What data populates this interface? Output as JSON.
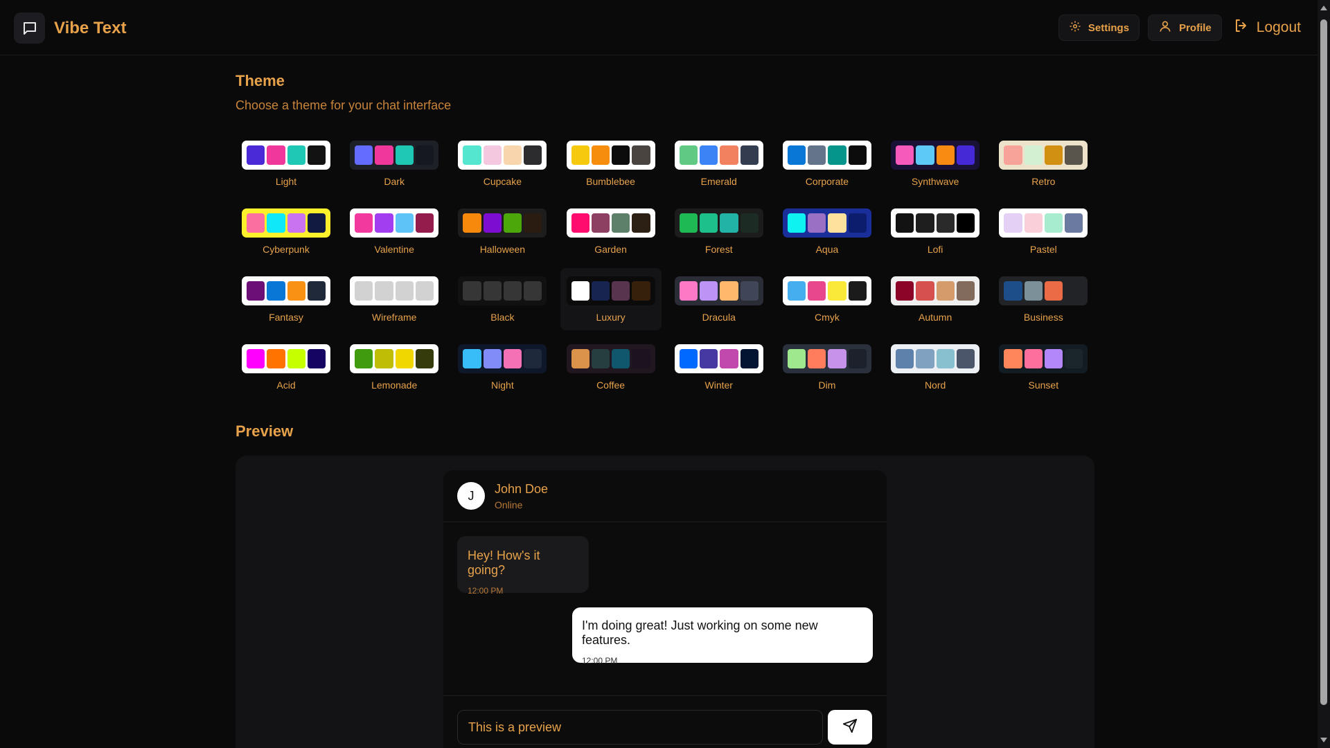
{
  "app": {
    "name": "Vibe Text"
  },
  "nav": {
    "settings": "Settings",
    "profile": "Profile",
    "logout": "Logout"
  },
  "theme_section": {
    "title": "Theme",
    "subtitle": "Choose a theme for your chat interface",
    "selected": "Luxury",
    "themes": [
      {
        "name": "Light",
        "colors": [
          "#4a2ad6",
          "#f0379b",
          "#1fc8b4",
          "#121212"
        ],
        "frame": "#ffffff"
      },
      {
        "name": "Dark",
        "colors": [
          "#646bff",
          "#f0379b",
          "#1fc8b4",
          "#151820"
        ],
        "frame": "#1d2026"
      },
      {
        "name": "Cupcake",
        "colors": [
          "#55e6cf",
          "#f4c9df",
          "#f9d5ad",
          "#2c2b2e"
        ],
        "frame": "#ffffff"
      },
      {
        "name": "Bumblebee",
        "colors": [
          "#f6c90e",
          "#f68d0c",
          "#0c0c0c",
          "#494440"
        ],
        "frame": "#ffffff"
      },
      {
        "name": "Emerald",
        "colors": [
          "#60c983",
          "#3c83f6",
          "#f2815f",
          "#343c4f"
        ],
        "frame": "#ffffff"
      },
      {
        "name": "Corporate",
        "colors": [
          "#0877d6",
          "#64748b",
          "#06958a",
          "#0c0c0c"
        ],
        "frame": "#ffffff"
      },
      {
        "name": "Synthwave",
        "colors": [
          "#f65aba",
          "#5cc9f7",
          "#f98b12",
          "#4528d6"
        ],
        "frame": "#1a1236"
      },
      {
        "name": "Retro",
        "colors": [
          "#f7a39a",
          "#d4f0d2",
          "#d29012",
          "#59554d"
        ],
        "frame": "#ece3ca"
      },
      {
        "name": "Cyberpunk",
        "colors": [
          "#fa6ea0",
          "#0ee8f8",
          "#c973f0",
          "#111a40"
        ],
        "frame": "#fcef2c"
      },
      {
        "name": "Valentine",
        "colors": [
          "#f2399e",
          "#a23ef0",
          "#5ec3f7",
          "#931c4c"
        ],
        "frame": "#ffffff"
      },
      {
        "name": "Halloween",
        "colors": [
          "#f78a0c",
          "#7d0dd0",
          "#4ca80a",
          "#2a1c10"
        ],
        "frame": "#1d1d1d"
      },
      {
        "name": "Garden",
        "colors": [
          "#ff0c6e",
          "#8d4062",
          "#5d806b",
          "#2b2013"
        ],
        "frame": "#ffffff"
      },
      {
        "name": "Forest",
        "colors": [
          "#1eb855",
          "#1dc08b",
          "#23b3a6",
          "#1c2b23"
        ],
        "frame": "#1c1c1c"
      },
      {
        "name": "Aqua",
        "colors": [
          "#0ef2f2",
          "#9a70c4",
          "#fde19c",
          "#0d1d6e"
        ],
        "frame": "#1a2e9a"
      },
      {
        "name": "Lofi",
        "colors": [
          "#121212",
          "#1e1e1e",
          "#2a2a2a",
          "#000000"
        ],
        "frame": "#ffffff"
      },
      {
        "name": "Pastel",
        "colors": [
          "#e4d0f5",
          "#fbcfd9",
          "#a8ecd0",
          "#6a7aa0"
        ],
        "frame": "#ffffff"
      },
      {
        "name": "Fantasy",
        "colors": [
          "#6c0f77",
          "#0877d6",
          "#f99214",
          "#20293a"
        ],
        "frame": "#ffffff"
      },
      {
        "name": "Wireframe",
        "colors": [
          "#d2d2d2",
          "#d2d2d2",
          "#d2d2d2",
          "#d2d2d2"
        ],
        "frame": "#ffffff"
      },
      {
        "name": "Black",
        "colors": [
          "#363636",
          "#363636",
          "#363636",
          "#363636"
        ],
        "frame": "#111111"
      },
      {
        "name": "Luxury",
        "colors": [
          "#ffffff",
          "#182450",
          "#58344e",
          "#361f0b"
        ],
        "frame": "#0b0b0b"
      },
      {
        "name": "Dracula",
        "colors": [
          "#fd79c6",
          "#be93f6",
          "#ffb86c",
          "#414558"
        ],
        "frame": "#2a2c36"
      },
      {
        "name": "Cmyk",
        "colors": [
          "#45aeee",
          "#e8478e",
          "#fae939",
          "#1b1b1b"
        ],
        "frame": "#ffffff"
      },
      {
        "name": "Autumn",
        "colors": [
          "#8c0428",
          "#d75050",
          "#d59b6a",
          "#826b5c"
        ],
        "frame": "#f0f0f0"
      },
      {
        "name": "Business",
        "colors": [
          "#1d4e89",
          "#7c909a",
          "#ea6b45",
          "#212326"
        ],
        "frame": "#212326"
      },
      {
        "name": "Acid",
        "colors": [
          "#ff00ff",
          "#ff7300",
          "#c6ff00",
          "#150462"
        ],
        "frame": "#ffffff"
      },
      {
        "name": "Lemonade",
        "colors": [
          "#419b0e",
          "#bfbd05",
          "#f0d700",
          "#353b0a"
        ],
        "frame": "#ffffff"
      },
      {
        "name": "Night",
        "colors": [
          "#38bdf8",
          "#818cf8",
          "#f471b5",
          "#1e293b"
        ],
        "frame": "#0f172a"
      },
      {
        "name": "Coffee",
        "colors": [
          "#db924b",
          "#263e3f",
          "#10576d",
          "#1c1220"
        ],
        "frame": "#211720"
      },
      {
        "name": "Winter",
        "colors": [
          "#0069ff",
          "#463aa2",
          "#c148ac",
          "#021431"
        ],
        "frame": "#ffffff"
      },
      {
        "name": "Dim",
        "colors": [
          "#9fe88d",
          "#ff7d5c",
          "#c792e9",
          "#1c212b"
        ],
        "frame": "#2a303c"
      },
      {
        "name": "Nord",
        "colors": [
          "#5e81ac",
          "#81a1c1",
          "#88c0d0",
          "#4c566a"
        ],
        "frame": "#eceff4"
      },
      {
        "name": "Sunset",
        "colors": [
          "#ff865b",
          "#fd6f9c",
          "#b387fa",
          "#1b262c"
        ],
        "frame": "#121c22"
      }
    ]
  },
  "preview": {
    "title": "Preview",
    "contact": {
      "initial": "J",
      "name": "John Doe",
      "status": "Online"
    },
    "messages": [
      {
        "text": "Hey! How's it going?",
        "time": "12:00 PM",
        "direction": "incoming"
      },
      {
        "text": "I'm doing great! Just working on some new features.",
        "time": "12:00 PM",
        "direction": "outgoing"
      }
    ],
    "input_value": "This is a preview"
  },
  "icons": {
    "logo": "chat-bubble-icon",
    "settings": "gear-icon",
    "profile": "user-icon",
    "logout": "logout-icon",
    "send": "send-icon"
  },
  "colors": {
    "accent": "#e8a24a",
    "background": "#0a0a0b"
  }
}
